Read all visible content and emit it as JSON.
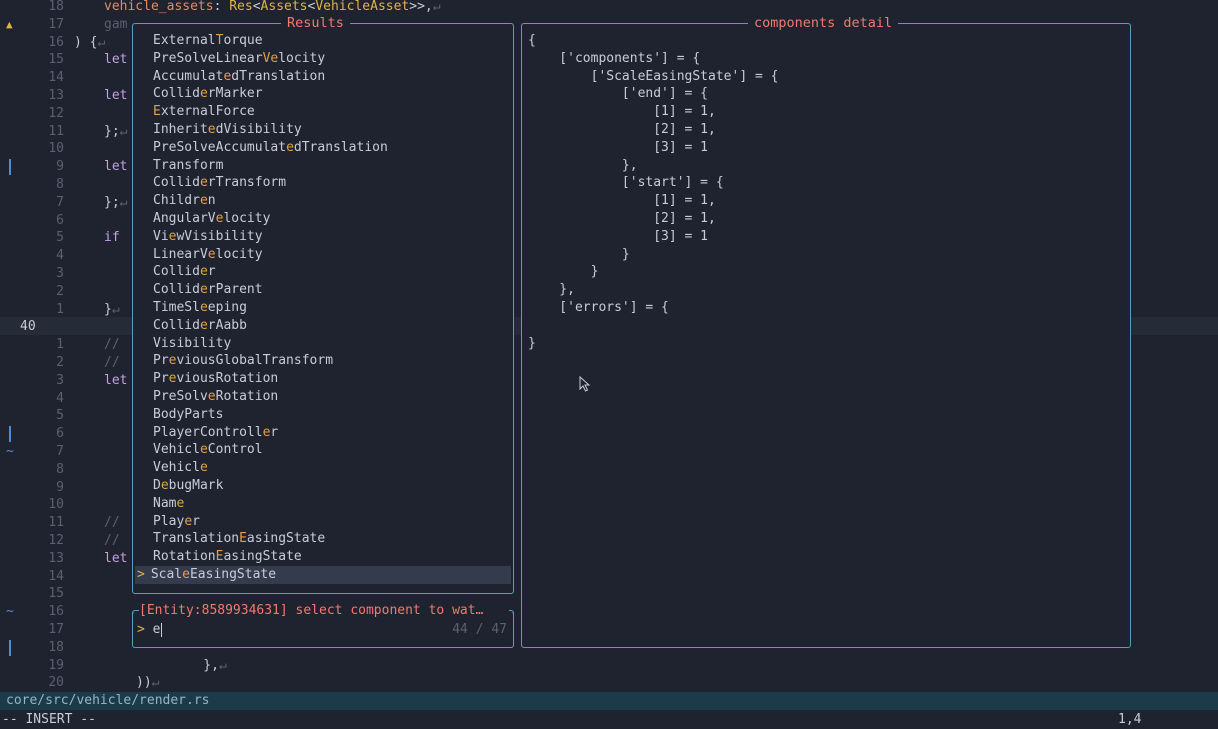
{
  "editor": {
    "current_line": "40",
    "lines": [
      {
        "num": "18",
        "sign": "",
        "code": [
          [
            "id",
            "vehicle_assets"
          ],
          [
            "",
            ": "
          ],
          [
            "ty",
            "Res"
          ],
          [
            "",
            "<"
          ],
          [
            "ty",
            "Assets"
          ],
          [
            "",
            "<"
          ],
          [
            "ty",
            "VehicleAsset"
          ],
          [
            "",
            ">>,"
          ],
          [
            "dim",
            "↵"
          ]
        ]
      },
      {
        "num": "17",
        "sign": "warn",
        "code": [
          [
            "cm",
            "gam"
          ]
        ]
      },
      {
        "num": "16",
        "sign": "",
        "code": [
          [
            "",
            ") {"
          ],
          [
            "dim",
            "↵"
          ]
        ],
        "offset": -30
      },
      {
        "num": "15",
        "sign": "",
        "code": [
          [
            "kw",
            "let"
          ]
        ]
      },
      {
        "num": "14",
        "sign": "",
        "code": []
      },
      {
        "num": "13",
        "sign": "",
        "code": [
          [
            "kw",
            "let"
          ]
        ]
      },
      {
        "num": "12",
        "sign": "",
        "code": []
      },
      {
        "num": "11",
        "sign": "",
        "code": [
          [
            "",
            "};"
          ],
          [
            "dim",
            "↵"
          ]
        ]
      },
      {
        "num": "10",
        "sign": "",
        "code": []
      },
      {
        "num": "9",
        "sign": "bar",
        "code": [
          [
            "kw",
            "let"
          ]
        ]
      },
      {
        "num": "8",
        "sign": "",
        "code": []
      },
      {
        "num": "7",
        "sign": "",
        "code": [
          [
            "",
            "};"
          ],
          [
            "dim",
            "↵"
          ]
        ]
      },
      {
        "num": "6",
        "sign": "",
        "code": []
      },
      {
        "num": "5",
        "sign": "",
        "code": [
          [
            "kw",
            "if"
          ]
        ]
      },
      {
        "num": "4",
        "sign": "",
        "code": []
      },
      {
        "num": "3",
        "sign": "",
        "code": []
      },
      {
        "num": "2",
        "sign": "",
        "code": []
      },
      {
        "num": "1",
        "sign": "",
        "code": [
          [
            "",
            "}"
          ],
          [
            "dim",
            "↵"
          ]
        ]
      },
      {
        "num": "40",
        "sign": "",
        "code": [],
        "current": true
      },
      {
        "num": "1",
        "sign": "",
        "code": [
          [
            "cm",
            "//"
          ]
        ]
      },
      {
        "num": "2",
        "sign": "",
        "code": [
          [
            "cm",
            "//"
          ]
        ]
      },
      {
        "num": "3",
        "sign": "",
        "code": [
          [
            "kw",
            "let"
          ]
        ]
      },
      {
        "num": "4",
        "sign": "",
        "code": []
      },
      {
        "num": "5",
        "sign": "",
        "code": []
      },
      {
        "num": "6",
        "sign": "bar",
        "code": []
      },
      {
        "num": "7",
        "sign": "tilde",
        "code": []
      },
      {
        "num": "8",
        "sign": "",
        "code": []
      },
      {
        "num": "9",
        "sign": "",
        "code": []
      },
      {
        "num": "10",
        "sign": "",
        "code": []
      },
      {
        "num": "11",
        "sign": "",
        "code": [
          [
            "cm",
            "//"
          ]
        ]
      },
      {
        "num": "12",
        "sign": "",
        "code": [
          [
            "cm",
            "//"
          ]
        ]
      },
      {
        "num": "13",
        "sign": "",
        "code": [
          [
            "kw",
            "let"
          ]
        ]
      },
      {
        "num": "14",
        "sign": "",
        "code": []
      },
      {
        "num": "15",
        "sign": "",
        "code": []
      },
      {
        "num": "16",
        "sign": "tilde",
        "code": []
      },
      {
        "num": "17",
        "sign": "",
        "code": []
      },
      {
        "num": "18",
        "sign": "bar",
        "code": []
      },
      {
        "num": "19",
        "sign": "",
        "code": [
          [
            "",
            "    },"
          ],
          [
            "dim",
            "↵"
          ]
        ],
        "indent": 68
      },
      {
        "num": "20",
        "sign": "",
        "code": [
          [
            "",
            "))"
          ],
          [
            "dim",
            "↵"
          ]
        ],
        "indent": 32
      }
    ]
  },
  "results": {
    "title": "Results",
    "items": [
      [
        [
          "",
          "External"
        ],
        [
          "hl",
          "T"
        ],
        [
          "",
          "orque"
        ]
      ],
      [
        [
          "",
          "PreSolveLinear"
        ],
        [
          "hl",
          "Ve"
        ],
        [
          "",
          "locity"
        ]
      ],
      [
        [
          "",
          "Accumulat"
        ],
        [
          "hl",
          "e"
        ],
        [
          "",
          "dTranslation"
        ]
      ],
      [
        [
          "",
          "Collid"
        ],
        [
          "hl",
          "e"
        ],
        [
          "",
          "rMarker"
        ]
      ],
      [
        [
          "hl",
          "E"
        ],
        [
          "",
          "xternalForce"
        ]
      ],
      [
        [
          "",
          "Inherit"
        ],
        [
          "hl",
          "e"
        ],
        [
          "",
          "dVisibility"
        ]
      ],
      [
        [
          "",
          "PreSolveAccumulat"
        ],
        [
          "hl",
          "e"
        ],
        [
          "",
          "dTranslation"
        ]
      ],
      [
        [
          "",
          "Transform"
        ]
      ],
      [
        [
          "",
          "Collid"
        ],
        [
          "hl",
          "e"
        ],
        [
          "",
          "rTransform"
        ]
      ],
      [
        [
          "",
          "Childr"
        ],
        [
          "hl",
          "e"
        ],
        [
          "",
          "n"
        ]
      ],
      [
        [
          "",
          "AngularV"
        ],
        [
          "hl",
          "e"
        ],
        [
          "",
          "locity"
        ]
      ],
      [
        [
          "",
          "Vi"
        ],
        [
          "hl",
          "e"
        ],
        [
          "",
          "wVisibility"
        ]
      ],
      [
        [
          "",
          "LinearV"
        ],
        [
          "hl",
          "e"
        ],
        [
          "",
          "locity"
        ]
      ],
      [
        [
          "",
          "Collid"
        ],
        [
          "hl",
          "e"
        ],
        [
          "",
          "r"
        ]
      ],
      [
        [
          "",
          "Collid"
        ],
        [
          "hl",
          "e"
        ],
        [
          "",
          "rParent"
        ]
      ],
      [
        [
          "",
          "TimeSl"
        ],
        [
          "hl",
          "e"
        ],
        [
          "",
          "eping"
        ]
      ],
      [
        [
          "",
          "Collid"
        ],
        [
          "hl",
          "e"
        ],
        [
          "",
          "rAabb"
        ]
      ],
      [
        [
          "",
          "Visibility"
        ]
      ],
      [
        [
          "",
          "Pr"
        ],
        [
          "hl",
          "e"
        ],
        [
          "",
          "viousGlobalTransform"
        ]
      ],
      [
        [
          "",
          "Pr"
        ],
        [
          "hl",
          "e"
        ],
        [
          "",
          "viousRotation"
        ]
      ],
      [
        [
          "",
          "PreSolv"
        ],
        [
          "hl",
          "e"
        ],
        [
          "",
          "Rotation"
        ]
      ],
      [
        [
          "",
          "BodyParts"
        ]
      ],
      [
        [
          "",
          "PlayerControll"
        ],
        [
          "hl",
          "e"
        ],
        [
          "",
          "r"
        ]
      ],
      [
        [
          "",
          "Vehicl"
        ],
        [
          "hl",
          "e"
        ],
        [
          "",
          "Control"
        ]
      ],
      [
        [
          "",
          "Vehicl"
        ],
        [
          "hl",
          "e"
        ]
      ],
      [
        [
          "",
          "D"
        ],
        [
          "hl",
          "e"
        ],
        [
          "",
          "bugMark"
        ]
      ],
      [
        [
          "",
          "Nam"
        ],
        [
          "hl",
          "e"
        ]
      ],
      [
        [
          "",
          "Play"
        ],
        [
          "hl",
          "e"
        ],
        [
          "",
          "r"
        ]
      ],
      [
        [
          "",
          "Translation"
        ],
        [
          "hl",
          "E"
        ],
        [
          "",
          "asingState"
        ]
      ],
      [
        [
          "",
          "Rotation"
        ],
        [
          "hl",
          "E"
        ],
        [
          "",
          "asingState"
        ]
      ],
      [
        [
          "",
          "Scal"
        ],
        [
          "hl",
          "e"
        ],
        [
          "",
          "EasingState"
        ]
      ]
    ],
    "selected_index": 30,
    "selected_marker": ">"
  },
  "detail": {
    "title": "components detail",
    "lines": [
      "{",
      "    ['components'] = {",
      "        ['ScaleEasingState'] = {",
      "            ['end'] = {",
      "                [1] = 1,",
      "                [2] = 1,",
      "                [3] = 1",
      "            },",
      "            ['start'] = {",
      "                [1] = 1,",
      "                [2] = 1,",
      "                [3] = 1",
      "            }",
      "        }",
      "    },",
      "    ['errors'] = {",
      "",
      "}"
    ]
  },
  "prompt": {
    "title": "[Entity:8589934631] select component to wat…",
    "caret": ">",
    "value": "e",
    "count": "44 / 47"
  },
  "statusline": {
    "file": "core/src/vehicle/render.rs"
  },
  "cmdline": {
    "mode": "-- INSERT --",
    "position": "1,4"
  },
  "colors": {
    "background": "#1f2330",
    "border": "#4fa3b8",
    "title": "#f07a6e",
    "match_highlight": "#e0a04a"
  }
}
